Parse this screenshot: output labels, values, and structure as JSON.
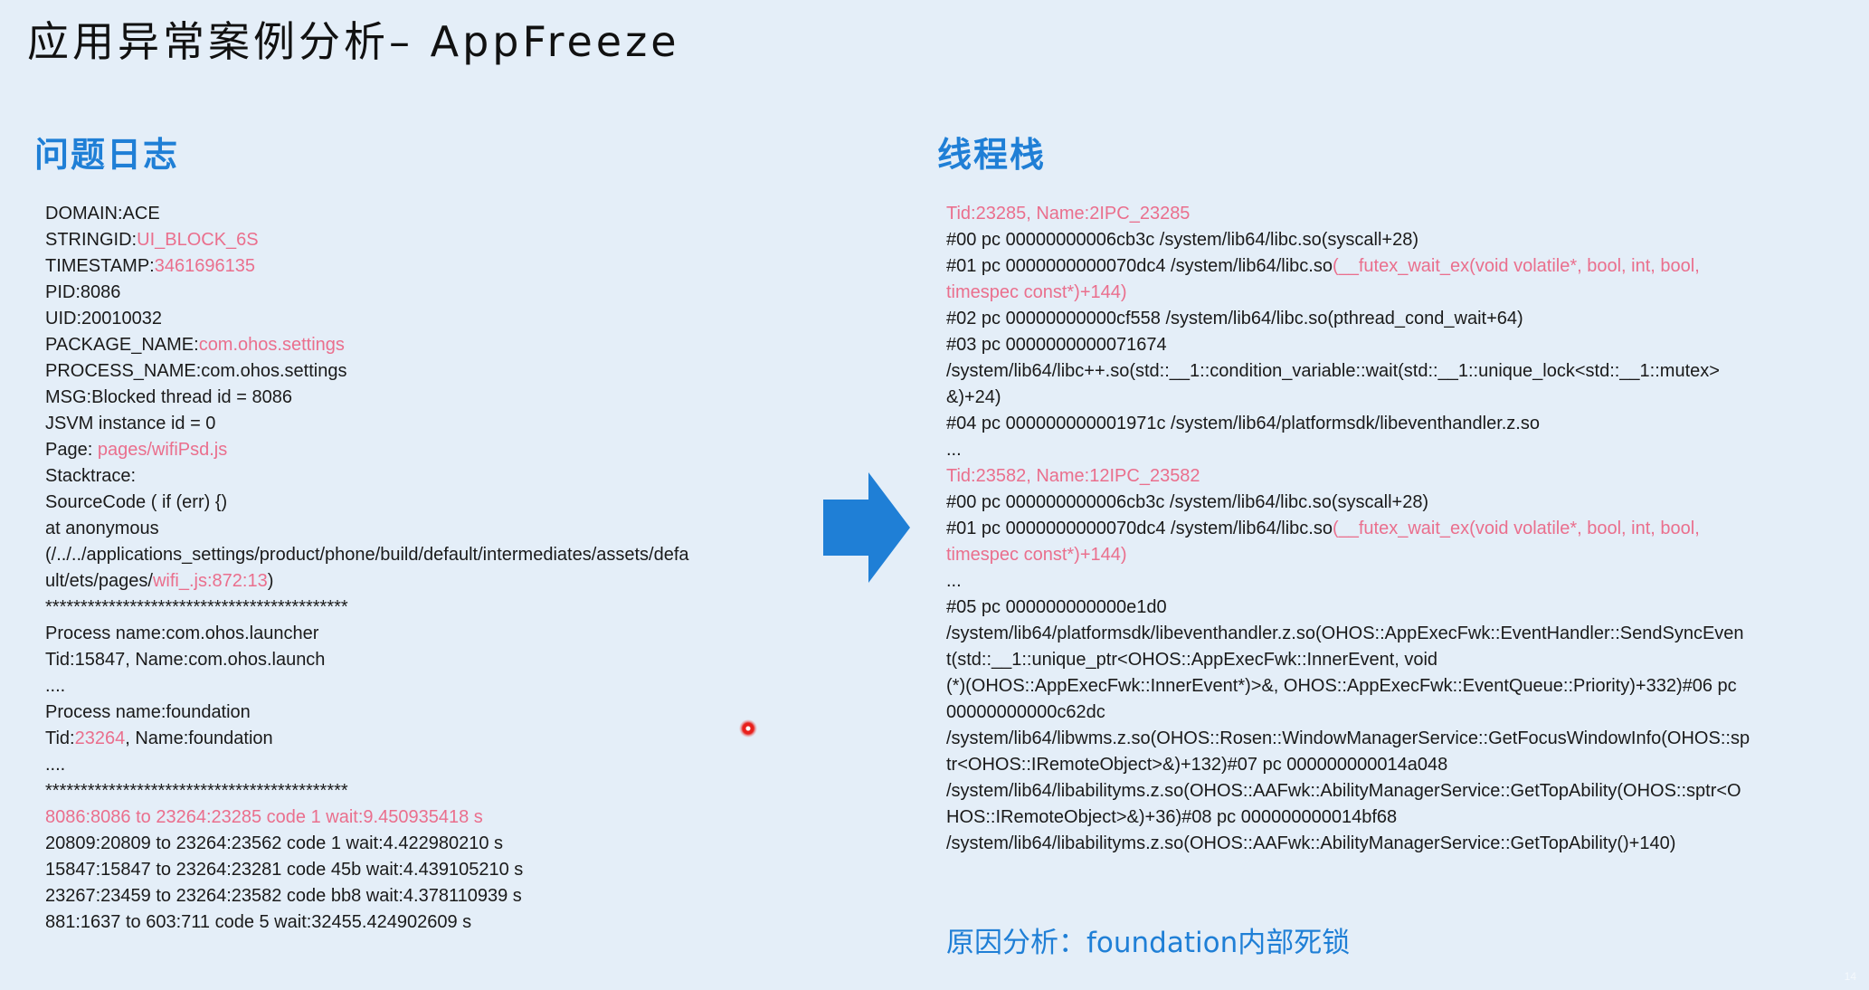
{
  "title": "应用异常案例分析– AppFreeze",
  "left_section": {
    "heading": "问题日志",
    "lines": [
      [
        {
          "t": "DOMAIN:ACE"
        }
      ],
      [
        {
          "t": "STRINGID:"
        },
        {
          "t": "UI_BLOCK_6S",
          "hl": true
        }
      ],
      [
        {
          "t": "TIMESTAMP:"
        },
        {
          "t": "3461696135",
          "hl": true
        }
      ],
      [
        {
          "t": "PID:8086"
        }
      ],
      [
        {
          "t": "UID:20010032"
        }
      ],
      [
        {
          "t": "PACKAGE_NAME:"
        },
        {
          "t": "com.ohos.settings",
          "hl": true
        }
      ],
      [
        {
          "t": "PROCESS_NAME:com.ohos.settings"
        }
      ],
      [
        {
          "t": "MSG:Blocked thread id = 8086"
        }
      ],
      [
        {
          "t": "JSVM instance id = 0"
        }
      ],
      [
        {
          "t": "Page: "
        },
        {
          "t": "pages/wifiPsd.js",
          "hl": true
        }
      ],
      [
        {
          "t": "Stacktrace:"
        }
      ],
      [
        {
          "t": "SourceCode ( if (err) {)"
        }
      ],
      [
        {
          "t": "at anonymous"
        }
      ],
      [
        {
          "t": "(/../../applications_settings/product/phone/build/default/intermediates/assets/defa"
        }
      ],
      [
        {
          "t": "ult/ets/pages/"
        },
        {
          "t": "wifi_.js:872:13",
          "hl": true
        },
        {
          "t": ")"
        }
      ],
      [
        {
          "t": "*******************************************"
        }
      ],
      [
        {
          "t": "Process name:com.ohos.launcher"
        }
      ],
      [
        {
          "t": "Tid:15847, Name:com.ohos.launch"
        }
      ],
      [
        {
          "t": "...."
        }
      ],
      [
        {
          "t": "Process name:foundation"
        }
      ],
      [
        {
          "t": "Tid:"
        },
        {
          "t": "23264",
          "hl": true
        },
        {
          "t": ", Name:foundation"
        }
      ],
      [
        {
          "t": "...."
        }
      ],
      [
        {
          "t": "*******************************************"
        }
      ],
      [
        {
          "t": "8086:8086 to 23264:23285 code 1 wait:9.450935418 s",
          "hl": true
        }
      ],
      [
        {
          "t": "20809:20809 to 23264:23562 code 1 wait:4.422980210 s"
        }
      ],
      [
        {
          "t": "15847:15847 to 23264:23281 code 45b wait:4.439105210 s"
        }
      ],
      [
        {
          "t": "23267:23459 to 23264:23582 code bb8 wait:4.378110939 s"
        }
      ],
      [
        {
          "t": "881:1637 to 603:711 code 5 wait:32455.424902609 s"
        }
      ]
    ]
  },
  "right_section": {
    "heading": "线程栈",
    "lines": [
      [
        {
          "t": "Tid:23285, Name:2IPC_23285",
          "hl": true
        }
      ],
      [
        {
          "t": "#00 pc 00000000006cb3c /system/lib64/libc.so(syscall+28)"
        }
      ],
      [
        {
          "t": "#01 pc 0000000000070dc4 /system/lib64/libc.so"
        },
        {
          "t": "(__futex_wait_ex(void volatile*, bool, int, bool,",
          "hl": true
        }
      ],
      [
        {
          "t": "timespec const*)+144)",
          "hl": true
        }
      ],
      [
        {
          "t": "#02 pc 00000000000cf558 /system/lib64/libc.so(pthread_cond_wait+64)"
        }
      ],
      [
        {
          "t": "#03 pc 0000000000071674"
        }
      ],
      [
        {
          "t": "/system/lib64/libc++.so(std::__1::condition_variable::wait(std::__1::unique_lock<std::__1::mutex>"
        }
      ],
      [
        {
          "t": "&)+24)"
        }
      ],
      [
        {
          "t": "#04 pc 000000000001971c /system/lib64/platformsdk/libeventhandler.z.so"
        }
      ],
      [
        {
          "t": "..."
        }
      ],
      [
        {
          "t": "Tid:23582, Name:12IPC_23582",
          "hl": true
        }
      ],
      [
        {
          "t": "#00 pc 000000000006cb3c /system/lib64/libc.so(syscall+28)"
        }
      ],
      [
        {
          "t": "#01 pc 0000000000070dc4 /system/lib64/libc.so"
        },
        {
          "t": "(__futex_wait_ex(void volatile*, bool, int, bool,",
          "hl": true
        }
      ],
      [
        {
          "t": "timespec const*)+144)",
          "hl": true
        }
      ],
      [
        {
          "t": "..."
        }
      ],
      [
        {
          "t": "#05 pc 000000000000e1d0"
        }
      ],
      [
        {
          "t": "/system/lib64/platformsdk/libeventhandler.z.so(OHOS::AppExecFwk::EventHandler::SendSyncEven"
        }
      ],
      [
        {
          "t": "t(std::__1::unique_ptr<OHOS::AppExecFwk::InnerEvent, void"
        }
      ],
      [
        {
          "t": "(*)(OHOS::AppExecFwk::InnerEvent*)>&, OHOS::AppExecFwk::EventQueue::Priority)+332)#06 pc"
        }
      ],
      [
        {
          "t": "00000000000c62dc"
        }
      ],
      [
        {
          "t": "/system/lib64/libwms.z.so(OHOS::Rosen::WindowManagerService::GetFocusWindowInfo(OHOS::sp"
        }
      ],
      [
        {
          "t": "tr<OHOS::IRemoteObject>&)+132)#07 pc 000000000014a048"
        }
      ],
      [
        {
          "t": "/system/lib64/libabilityms.z.so(OHOS::AAFwk::AbilityManagerService::GetTopAbility(OHOS::sptr<O"
        }
      ],
      [
        {
          "t": "HOS::IRemoteObject>&)+36)#08 pc 000000000014bf68"
        }
      ],
      [
        {
          "t": "/system/lib64/libabilityms.z.so(OHOS::AAFwk::AbilityManagerService::GetTopAbility()+140)"
        }
      ]
    ]
  },
  "cause": "原因分析：foundation内部死锁",
  "page_number": "14",
  "colors": {
    "highlight": "#ea6f8d",
    "accent": "#1f7fd6",
    "background": "#e4eef8"
  }
}
